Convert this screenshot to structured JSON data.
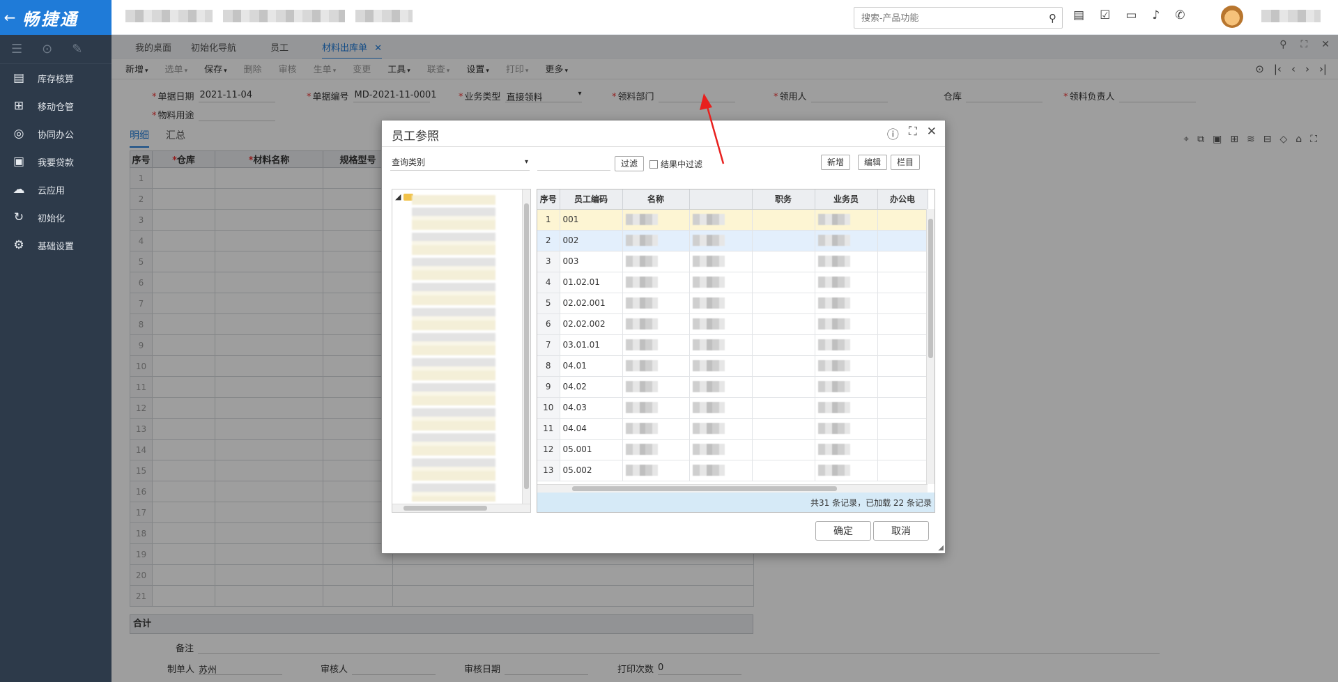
{
  "brand": {
    "back_icon": "←",
    "name": "畅捷通"
  },
  "search": {
    "placeholder": "搜索-产品功能"
  },
  "sidebar": {
    "items": [
      {
        "label": "库存核算"
      },
      {
        "label": "移动仓管"
      },
      {
        "label": "协同办公"
      },
      {
        "label": "我要贷款"
      },
      {
        "label": "云应用"
      },
      {
        "label": "初始化"
      },
      {
        "label": "基础设置"
      }
    ]
  },
  "tabs": [
    {
      "label": "我的桌面"
    },
    {
      "label": "初始化导航"
    },
    {
      "label": "员工"
    },
    {
      "label": "材料出库单"
    }
  ],
  "toolbar": {
    "items": [
      {
        "label": "新增",
        "caret": "▾"
      },
      {
        "label": "选单",
        "caret": "▾"
      },
      {
        "label": "保存",
        "caret": "▾"
      },
      {
        "label": "删除",
        "caret": ""
      },
      {
        "label": "审核",
        "caret": ""
      },
      {
        "label": "生单",
        "caret": "▾"
      },
      {
        "label": "变更",
        "caret": ""
      },
      {
        "label": "工具",
        "caret": "▾"
      },
      {
        "label": "联查",
        "caret": "▾"
      },
      {
        "label": "设置",
        "caret": "▾"
      },
      {
        "label": "打印",
        "caret": "▾"
      },
      {
        "label": "更多",
        "caret": "▾"
      }
    ]
  },
  "form": {
    "doc_date_label": "单据日期",
    "doc_date": "2021-11-04",
    "doc_no_label": "单据编号",
    "doc_no": "MD-2021-11-0001",
    "biz_type_label": "业务类型",
    "biz_type": "直接领料",
    "dept_label": "领料部门",
    "user_label": "领用人",
    "warehouse_label": "仓库",
    "owner_label": "领料负责人",
    "purpose_label": "物料用途"
  },
  "sub_tabs": {
    "detail": "明细",
    "summary": "汇总"
  },
  "grid": {
    "headers": [
      "序号",
      "仓库",
      "材料名称",
      "规格型号"
    ],
    "required": [
      false,
      true,
      true,
      false
    ],
    "rows": [
      "1",
      "2",
      "3",
      "4",
      "5",
      "6",
      "7",
      "8",
      "9",
      "10",
      "11",
      "12",
      "13",
      "14",
      "15",
      "16",
      "17",
      "18",
      "19",
      "20",
      "21"
    ],
    "total_label": "合计"
  },
  "footer": {
    "remark_label": "备注",
    "creator_label": "制单人",
    "creator": "苏州",
    "auditor_label": "审核人",
    "audit_date_label": "审核日期",
    "print_count_label": "打印次数",
    "print_count": "0"
  },
  "dialog": {
    "title": "员工参照",
    "filter_placeholder": "查询类别",
    "filter_btn": "过滤",
    "in_result_label": "结果中过滤",
    "new_btn": "新增",
    "edit_btn": "编辑",
    "column_btn": "栏目",
    "headers": [
      "序号",
      "员工编码",
      "名称",
      "",
      "职务",
      "业务员",
      "办公电"
    ],
    "rows": [
      {
        "n": "1",
        "code": "001"
      },
      {
        "n": "2",
        "code": "002"
      },
      {
        "n": "3",
        "code": "003"
      },
      {
        "n": "4",
        "code": "01.02.01"
      },
      {
        "n": "5",
        "code": "02.02.001"
      },
      {
        "n": "6",
        "code": "02.02.002"
      },
      {
        "n": "7",
        "code": "03.01.01"
      },
      {
        "n": "8",
        "code": "04.01"
      },
      {
        "n": "9",
        "code": "04.02"
      },
      {
        "n": "10",
        "code": "04.03"
      },
      {
        "n": "11",
        "code": "04.04"
      },
      {
        "n": "12",
        "code": "05.001"
      },
      {
        "n": "13",
        "code": "05.002"
      }
    ],
    "record_info": "共31 条记录，已加载 22 条记录",
    "ok": "确定",
    "cancel": "取消"
  }
}
